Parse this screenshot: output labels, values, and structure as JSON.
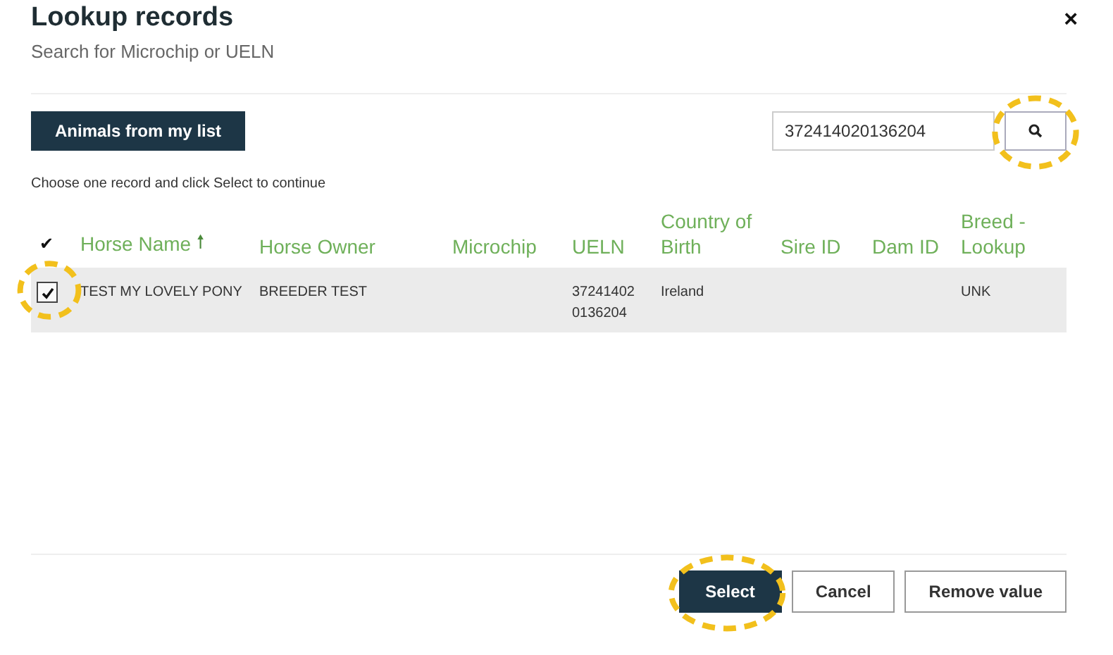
{
  "dialog": {
    "title": "Lookup records",
    "subtitle": "Search for Microchip or UELN",
    "close": "×"
  },
  "toolbar": {
    "list_button": "Animals from my list",
    "search": {
      "value": "372414020136204",
      "highlighted": true
    }
  },
  "instruction": "Choose one record and click Select to continue",
  "table": {
    "header_check": "✔",
    "sort_arrow": "🠕",
    "columns": [
      "Horse Name",
      "Horse Owner",
      "Microchip",
      "UELN",
      "Country of Birth",
      "Sire ID",
      "Dam ID",
      "Breed - Lookup"
    ],
    "rows": [
      {
        "checked": true,
        "highlighted": true,
        "cells": [
          "TEST MY LOVELY PONY",
          "BREEDER TEST",
          "",
          "37241402 0136204",
          "Ireland",
          "",
          "",
          "UNK"
        ]
      }
    ]
  },
  "buttons": [
    {
      "label": "Select",
      "kind": "primary",
      "highlighted": true
    },
    {
      "label": "Cancel",
      "kind": "secondary",
      "highlighted": false
    },
    {
      "label": "Remove value",
      "kind": "secondary",
      "highlighted": false
    }
  ]
}
